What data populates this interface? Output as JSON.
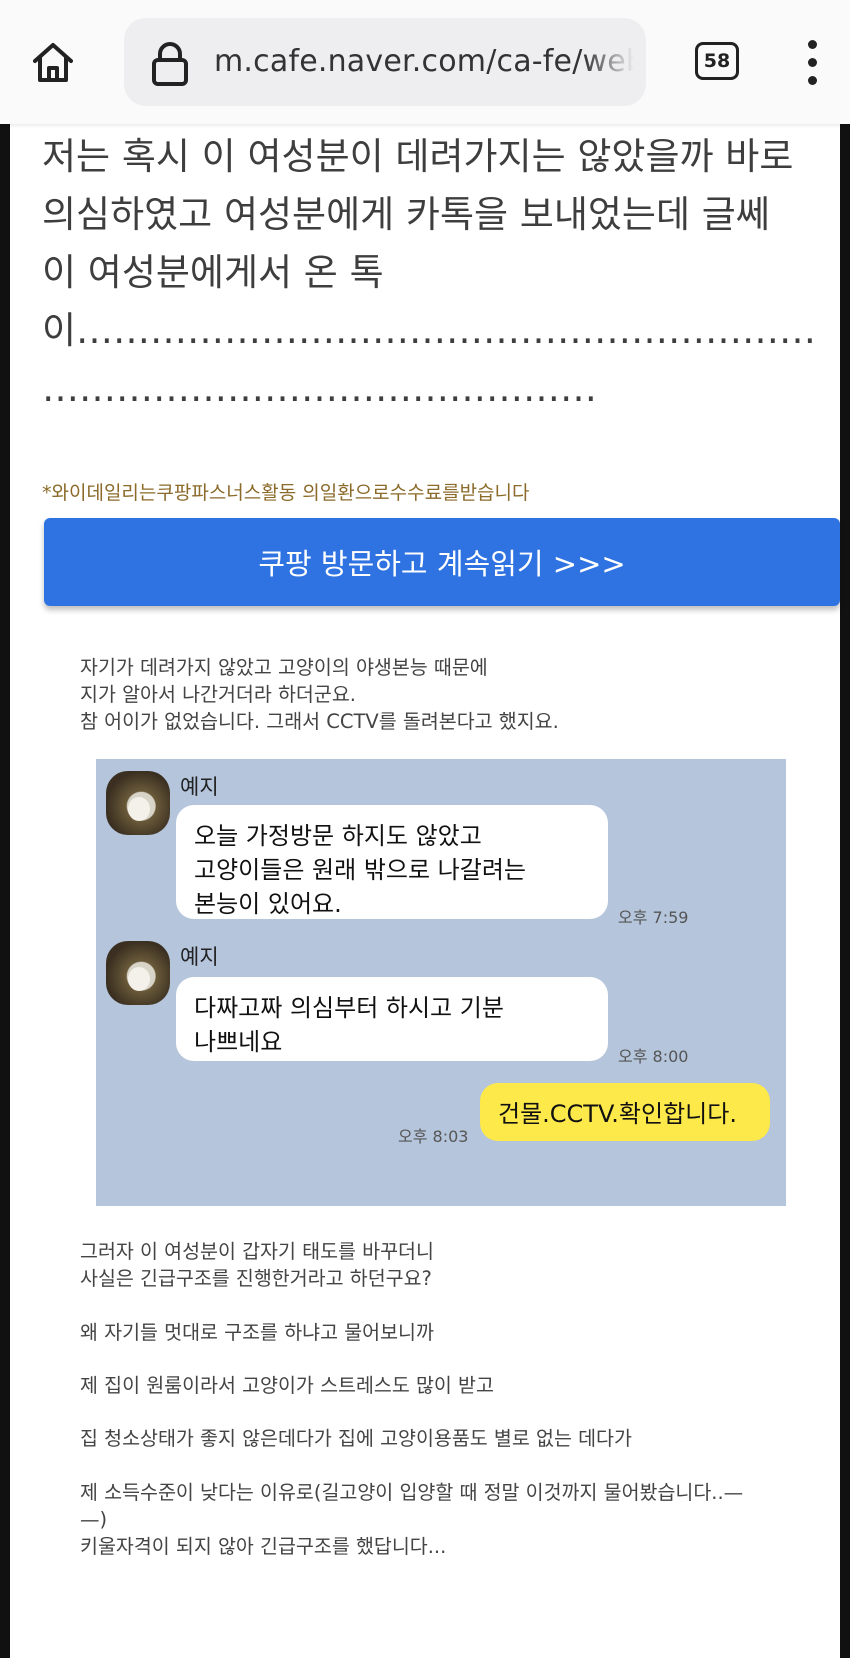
{
  "browser": {
    "url": "m.cafe.naver.com/ca-fe/web/",
    "tab_count": "58",
    "icons": {
      "home": "home-icon",
      "lock": "lock-icon",
      "menu": "more-vert-icon"
    }
  },
  "article": {
    "lines": [
      "저는 혹시 이 여성분이 데려가지는 않았을까 바로",
      "의심하였고 여성분에게 카톡을 보내었는데 글쎄",
      "이 여성분에게서 온 톡",
      "이………………………………………………………",
      "………………………………………"
    ],
    "disclaimer": "*와이데일리는쿠팡파스너스활동 의일환으로수수료를받습니다",
    "cta_button": "쿠팡 방문하고 계속읽기 >>>",
    "para1": [
      "자기가 데려가지 않았고 고양이의 야생본능 때문에",
      "지가 알아서 나간거더라 하더군요.",
      "참 어이가 없었습니다. 그래서 CCTV를 돌려본다고 했지요."
    ],
    "para2": [
      "그러자 이 여성분이 갑자기 태도를 바꾸더니",
      "사실은 긴급구조를 진행한거라고 하던구요?",
      "왜 자기들 멋대로 구조를 하냐고 물어보니까",
      "제 집이 원룸이라서 고양이가 스트레스도 많이 받고",
      "집 청소상태가 좋지 않은데다가 집에 고양이용품도 별로 없는 데다가",
      "제 소득수준이 낮다는 이유로(길고양이 입양할 때 정말 이것까지 물어봤습니다..—",
      "—)",
      "키울자격이 되지 않아 긴급구조를 했답니다..."
    ]
  },
  "chat": {
    "bg_color": "#b5c5dc",
    "messages": [
      {
        "sender": "예지",
        "lines": [
          "오늘 가정방문 하지도 않았고",
          "고양이들은 원래 밖으로 나갈려는",
          "본능이 있어요."
        ],
        "time": "오후 7:59"
      },
      {
        "sender": "예지",
        "lines": [
          "다짜고짜 의심부터 하시고 기분",
          "나쁘네요"
        ],
        "time": "오후 8:00"
      },
      {
        "sender": "",
        "lines": [
          "건물.CCTV.확인합니다."
        ],
        "time": "오후 8:03"
      }
    ]
  }
}
